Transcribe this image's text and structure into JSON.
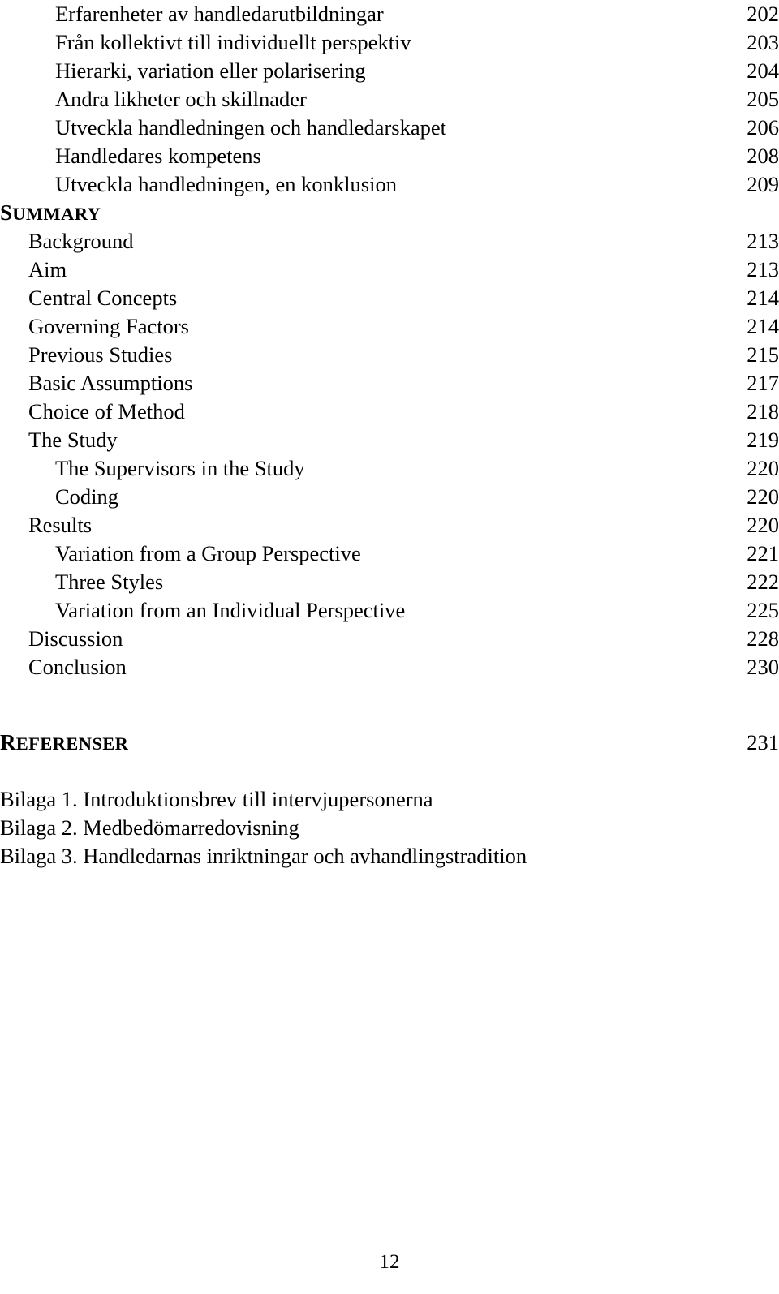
{
  "document": {
    "page_number": "12",
    "toc_entries": [
      {
        "label": "Erfarenheter av handledarutbildningar",
        "page": "202",
        "level": 2,
        "style": "normal"
      },
      {
        "label": "Från kollektivt till individuellt perspektiv",
        "page": "203",
        "level": 2,
        "style": "normal"
      },
      {
        "label": "Hierarki, variation eller polarisering",
        "page": "204",
        "level": 2,
        "style": "normal"
      },
      {
        "label": "Andra likheter och skillnader",
        "page": "205",
        "level": 2,
        "style": "normal"
      },
      {
        "label": "Utveckla handledningen och handledarskapet",
        "page": "206",
        "level": 2,
        "style": "normal"
      },
      {
        "label": "Handledares kompetens",
        "page": "208",
        "level": 2,
        "style": "normal"
      },
      {
        "label": "Utveckla handledningen, en konklusion",
        "page": "209",
        "level": 2,
        "style": "normal"
      },
      {
        "label": "SUMMARY",
        "lead": "S",
        "rest": "UMMARY",
        "page": "",
        "level": 0,
        "style": "smallcaps"
      },
      {
        "label": "Background",
        "page": "213",
        "level": 1,
        "style": "normal"
      },
      {
        "label": "Aim",
        "page": "213",
        "level": 1,
        "style": "normal"
      },
      {
        "label": "Central Concepts",
        "page": "214",
        "level": 1,
        "style": "normal"
      },
      {
        "label": "Governing Factors",
        "page": "214",
        "level": 1,
        "style": "normal"
      },
      {
        "label": "Previous Studies",
        "page": "215",
        "level": 1,
        "style": "normal"
      },
      {
        "label": "Basic Assumptions",
        "page": "217",
        "level": 1,
        "style": "normal"
      },
      {
        "label": "Choice of Method",
        "page": "218",
        "level": 1,
        "style": "normal"
      },
      {
        "label": "The Study",
        "page": "219",
        "level": 1,
        "style": "normal"
      },
      {
        "label": "The Supervisors in the Study",
        "page": "220",
        "level": 2,
        "style": "normal"
      },
      {
        "label": "Coding",
        "page": "220",
        "level": 2,
        "style": "normal"
      },
      {
        "label": "Results",
        "page": "220",
        "level": 1,
        "style": "normal"
      },
      {
        "label": "Variation from a Group Perspective",
        "page": "221",
        "level": 2,
        "style": "normal"
      },
      {
        "label": "Three Styles",
        "page": "222",
        "level": 2,
        "style": "normal"
      },
      {
        "label": "Variation from an Individual Perspective",
        "page": "225",
        "level": 2,
        "style": "normal"
      },
      {
        "label": "Discussion",
        "page": "228",
        "level": 1,
        "style": "normal"
      },
      {
        "label": "Conclusion",
        "page": "230",
        "level": 1,
        "style": "normal"
      }
    ],
    "references_heading": {
      "label": "REFERENSER",
      "lead": "R",
      "rest": "EFERENSER",
      "page": "231"
    },
    "appendices": [
      {
        "label": "Bilaga 1. Introduktionsbrev till intervjupersonerna"
      },
      {
        "label": "Bilaga 2. Medbedömarredovisning"
      },
      {
        "label": "Bilaga 3. Handledarnas inriktningar och avhandlingstradition"
      }
    ]
  }
}
